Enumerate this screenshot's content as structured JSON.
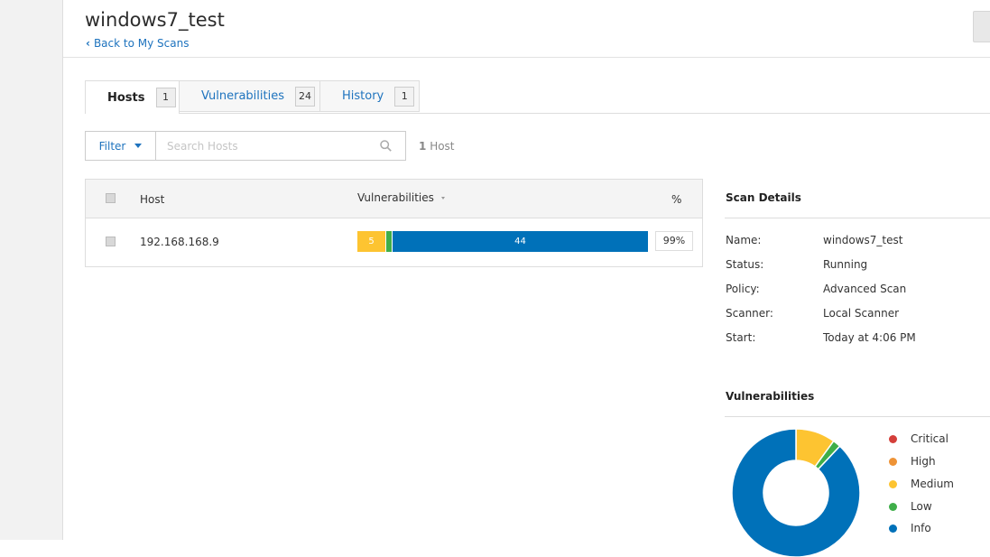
{
  "header": {
    "title": "windows7_test",
    "back_label": "Back to My Scans"
  },
  "tabs": [
    {
      "label": "Hosts",
      "count": "1",
      "active": true
    },
    {
      "label": "Vulnerabilities",
      "count": "24",
      "active": false
    },
    {
      "label": "History",
      "count": "1",
      "active": false
    }
  ],
  "toolbar": {
    "filter_label": "Filter",
    "search_placeholder": "Search Hosts",
    "host_count_num": "1",
    "host_count_word": "Host"
  },
  "table": {
    "columns": {
      "host": "Host",
      "vulnerabilities": "Vulnerabilities",
      "percent": "%"
    },
    "rows": [
      {
        "host": "192.168.168.9",
        "percent": "99%",
        "segments": {
          "medium_label": "5",
          "info_label": "44"
        }
      }
    ]
  },
  "scan_details": {
    "heading": "Scan Details",
    "fields": [
      {
        "label": "Name:",
        "value": "windows7_test"
      },
      {
        "label": "Status:",
        "value": "Running"
      },
      {
        "label": "Policy:",
        "value": "Advanced Scan"
      },
      {
        "label": "Scanner:",
        "value": "Local Scanner"
      },
      {
        "label": "Start:",
        "value": "Today at 4:06 PM"
      }
    ]
  },
  "vulnerabilities_panel": {
    "heading": "Vulnerabilities",
    "legend": [
      {
        "label": "Critical",
        "color": "#d43f3a"
      },
      {
        "label": "High",
        "color": "#ee9336"
      },
      {
        "label": "Medium",
        "color": "#fdc431"
      },
      {
        "label": "Low",
        "color": "#3fae49"
      },
      {
        "label": "Info",
        "color": "#0071b9"
      }
    ]
  },
  "chart_data": {
    "type": "pie",
    "categories": [
      "Critical",
      "High",
      "Medium",
      "Low",
      "Info"
    ],
    "values": [
      0,
      0,
      5,
      1,
      44
    ],
    "colors": [
      "#d43f3a",
      "#ee9336",
      "#fdc431",
      "#3fae49",
      "#0071b9"
    ],
    "title": "Vulnerabilities",
    "legend": "right"
  }
}
